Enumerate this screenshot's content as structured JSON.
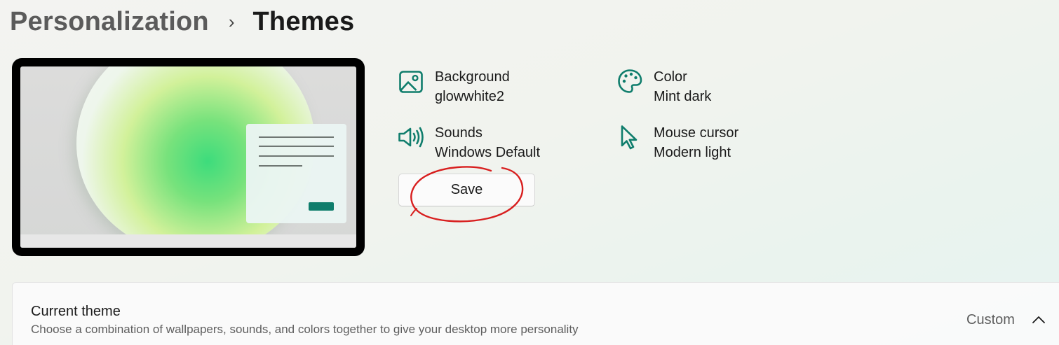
{
  "breadcrumb": {
    "parent": "Personalization",
    "separator": "›",
    "current": "Themes"
  },
  "theme_info": {
    "background": {
      "label": "Background",
      "value": "glowwhite2",
      "icon": "picture-icon"
    },
    "color": {
      "label": "Color",
      "value": "Mint dark",
      "icon": "palette-icon"
    },
    "sounds": {
      "label": "Sounds",
      "value": "Windows Default",
      "icon": "speaker-icon"
    },
    "mouse_cursor": {
      "label": "Mouse cursor",
      "value": "Modern light",
      "icon": "cursor-icon"
    }
  },
  "save_label": "Save",
  "current_theme": {
    "title": "Current theme",
    "subtitle": "Choose a combination of wallpapers, sounds, and colors together to give your desktop more personality",
    "value": "Custom",
    "expanded": true
  },
  "colors": {
    "accent": "#0f7d6c",
    "annotation": "#d81e1e"
  }
}
